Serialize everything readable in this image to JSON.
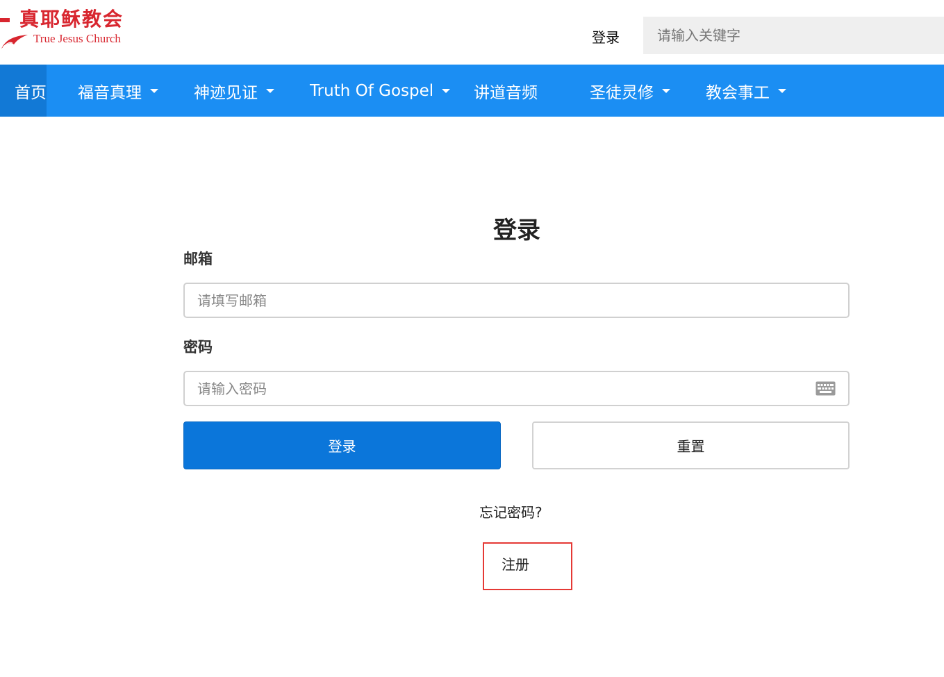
{
  "header": {
    "logo_cn": "真耶稣教会",
    "logo_en": "True Jesus Church",
    "login_label": "登录",
    "search_placeholder": "请输入关键字"
  },
  "nav": {
    "items": [
      {
        "label": "首页",
        "has_dropdown": false,
        "active": true
      },
      {
        "label": "福音真理",
        "has_dropdown": true
      },
      {
        "label": "神迹见证",
        "has_dropdown": true
      },
      {
        "label": "Truth Of Gospel",
        "has_dropdown": true
      },
      {
        "label": "讲道音频",
        "has_dropdown": false
      },
      {
        "label": "圣徒灵修",
        "has_dropdown": true
      },
      {
        "label": "教会事工",
        "has_dropdown": true
      }
    ]
  },
  "form": {
    "title": "登录",
    "email_label": "邮箱",
    "email_placeholder": "请填写邮箱",
    "password_label": "密码",
    "password_placeholder": "请输入密码",
    "submit_label": "登录",
    "reset_label": "重置",
    "forgot_label": "忘记密码?",
    "register_label": "注册"
  },
  "colors": {
    "brand_red": "#d8262f",
    "nav_blue": "#1b8ef3",
    "nav_active": "#1279d6",
    "primary_button": "#0b76da",
    "highlight_box": "#e53935"
  }
}
